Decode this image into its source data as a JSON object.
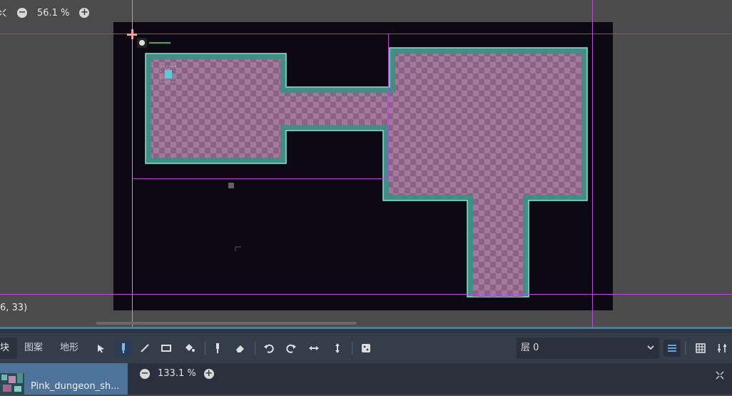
{
  "viewport": {
    "zoom": "56.1 %",
    "zoom_in_icon": "plus-circle-icon",
    "zoom_out_icon": "minus-circle-icon",
    "cursor_coords": "6, 33)"
  },
  "colors": {
    "floor_a": "#a3789a",
    "floor_b": "#8a6284",
    "wall": "#3f8f85",
    "wall_edge": "#8ee0d0",
    "background": "#0c0814",
    "guide_magenta": "#b04fd0",
    "guide_red": "#c03a48",
    "guide_green": "#8acd40"
  },
  "tilemap_panel": {
    "tabs": [
      "块",
      "图案",
      "地形"
    ],
    "tools": [
      "select-icon",
      "paint-icon",
      "line-icon",
      "rect-icon",
      "bucket-icon",
      "picker-icon",
      "eraser-icon",
      "rotate-left-icon",
      "rotate-right-icon",
      "flip-h-icon",
      "flip-v-icon",
      "random-icon"
    ],
    "layer_label": "层 0",
    "tileset_name": "Pink_dungeon_sh...",
    "atlas_zoom": "133.1 %"
  }
}
